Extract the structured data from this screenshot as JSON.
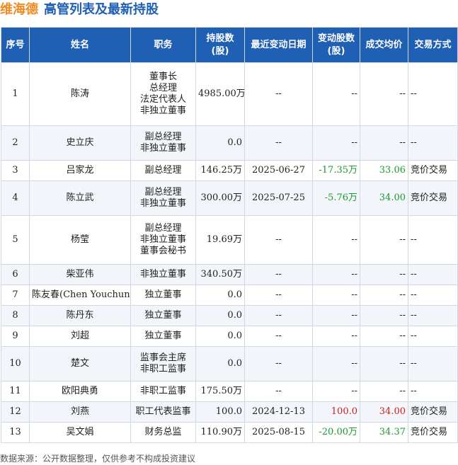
{
  "title": {
    "company": "维海德",
    "heading": "高管列表及最新持股"
  },
  "columns": [
    "序号",
    "姓名",
    "职务",
    "持股数(股)",
    "最近变动日期",
    "变动股数(股)",
    "成交均价",
    "交易方式"
  ],
  "rows": [
    {
      "no": "1",
      "name": "陈涛",
      "duties": [
        "董事长",
        "总经理",
        "法定代表人",
        "非独立董事"
      ],
      "shares": "4985.00万",
      "date": "--",
      "change": "--",
      "change_sign": "",
      "price": "--",
      "price_sign": "",
      "method": "--"
    },
    {
      "no": "2",
      "name": "史立庆",
      "duties": [
        "副总经理",
        "非独立董事"
      ],
      "shares": "0.0",
      "date": "--",
      "change": "--",
      "change_sign": "",
      "price": "--",
      "price_sign": "",
      "method": "--"
    },
    {
      "no": "3",
      "name": "吕家龙",
      "duties": [
        "副总经理"
      ],
      "shares": "146.25万",
      "date": "2025-06-27",
      "change": "-17.35万",
      "change_sign": "neg",
      "price": "33.06",
      "price_sign": "green",
      "method": "竞价交易"
    },
    {
      "no": "4",
      "name": "陈立武",
      "duties": [
        "副总经理",
        "非独立董事"
      ],
      "shares": "300.00万",
      "date": "2025-07-25",
      "change": "-5.76万",
      "change_sign": "neg",
      "price": "34.00",
      "price_sign": "green",
      "method": "竞价交易"
    },
    {
      "no": "5",
      "name": "杨莹",
      "duties": [
        "副总经理",
        "非独立董事",
        "董事会秘书"
      ],
      "shares": "19.69万",
      "date": "--",
      "change": "--",
      "change_sign": "",
      "price": "--",
      "price_sign": "",
      "method": "--"
    },
    {
      "no": "6",
      "name": "柴亚伟",
      "duties": [
        "非独立董事"
      ],
      "shares": "340.50万",
      "date": "--",
      "change": "--",
      "change_sign": "",
      "price": "--",
      "price_sign": "",
      "method": "--"
    },
    {
      "no": "7",
      "name": "陈友春(Chen Youchun)",
      "duties": [
        "独立董事"
      ],
      "shares": "0.0",
      "date": "--",
      "change": "--",
      "change_sign": "",
      "price": "--",
      "price_sign": "",
      "method": "--"
    },
    {
      "no": "8",
      "name": "陈丹东",
      "duties": [
        "独立董事"
      ],
      "shares": "0.0",
      "date": "--",
      "change": "--",
      "change_sign": "",
      "price": "--",
      "price_sign": "",
      "method": "--"
    },
    {
      "no": "9",
      "name": "刘超",
      "duties": [
        "独立董事"
      ],
      "shares": "0.0",
      "date": "--",
      "change": "--",
      "change_sign": "",
      "price": "--",
      "price_sign": "",
      "method": "--"
    },
    {
      "no": "10",
      "name": "楚文",
      "duties": [
        "监事会主席",
        "非职工监事"
      ],
      "shares": "0.0",
      "date": "--",
      "change": "--",
      "change_sign": "",
      "price": "--",
      "price_sign": "",
      "method": "--"
    },
    {
      "no": "11",
      "name": "欧阳典勇",
      "duties": [
        "非职工监事"
      ],
      "shares": "175.50万",
      "date": "--",
      "change": "--",
      "change_sign": "",
      "price": "--",
      "price_sign": "",
      "method": "--"
    },
    {
      "no": "12",
      "name": "刘燕",
      "duties": [
        "职工代表监事"
      ],
      "shares": "100.0",
      "date": "2024-12-13",
      "change": "100.0",
      "change_sign": "pos",
      "price": "34.00",
      "price_sign": "red",
      "method": "竞价交易"
    },
    {
      "no": "13",
      "name": "吴文娟",
      "duties": [
        "财务总监"
      ],
      "shares": "110.90万",
      "date": "2025-08-15",
      "change": "-20.00万",
      "change_sign": "neg",
      "price": "34.37",
      "price_sign": "green",
      "method": "竞价交易"
    }
  ],
  "footer": "数据来源：公开数据整理，仅供参考不构成投资建议"
}
